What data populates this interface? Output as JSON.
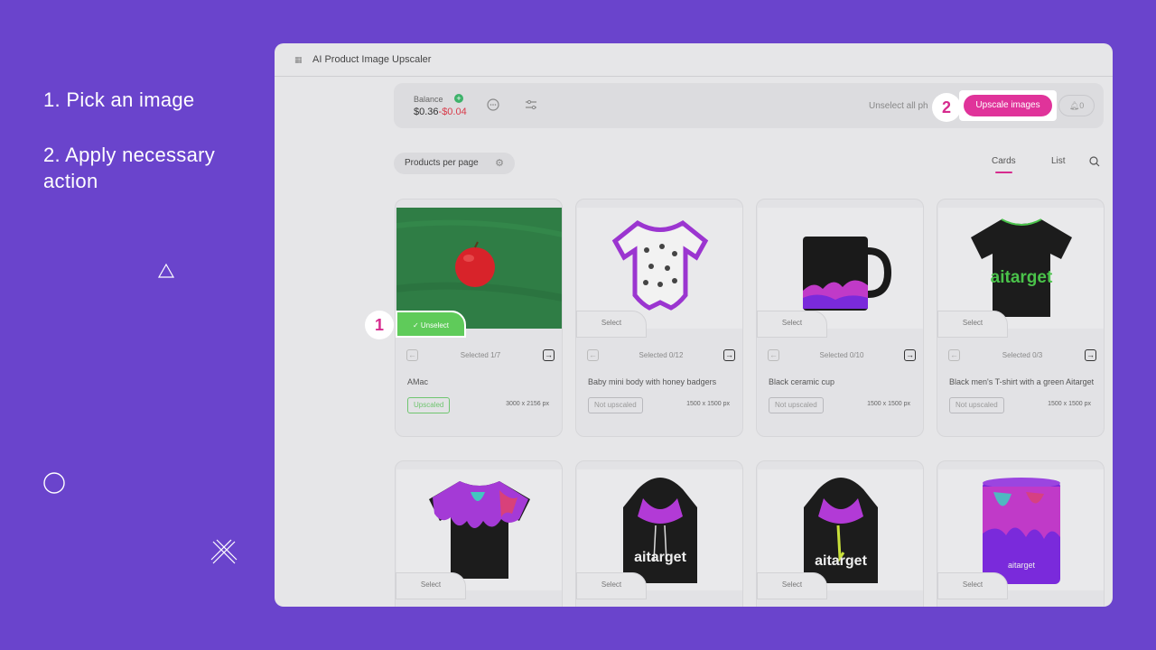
{
  "instructions": {
    "step1": "1. Pick an image",
    "step2": "2. Apply necessary action"
  },
  "window": {
    "title": "AI Product Image Upscaler"
  },
  "toolbar": {
    "balance_label": "Balance",
    "balance_plus": "+",
    "balance_value": "$0.36",
    "balance_deduct": "-$0.04",
    "unselect_all": "Unselect all ph",
    "upscale_label": "Upscale images",
    "notifications": "0"
  },
  "badges": {
    "one": "1",
    "two": "2"
  },
  "filters": {
    "products_per_page": "Products per page",
    "tab_cards": "Cards",
    "tab_list": "List"
  },
  "cards": [
    {
      "name": "AMac",
      "selected": "Selected 1/7",
      "status": "Upscaled",
      "dims": "3000 x 2156 px",
      "action": "Unselect"
    },
    {
      "name": "Baby mini body with honey badgers",
      "selected": "Selected 0/12",
      "status": "Not upscaled",
      "dims": "1500 x 1500 px",
      "action": "Select"
    },
    {
      "name": "Black ceramic cup",
      "selected": "Selected 0/10",
      "status": "Not upscaled",
      "dims": "1500 x 1500 px",
      "action": "Select"
    },
    {
      "name": "Black men's T-shirt with a green Aitarget",
      "selected": "Selected 0/3",
      "status": "Not upscaled",
      "dims": "1500 x 1500 px",
      "action": "Select"
    },
    {
      "action": "Select"
    },
    {
      "action": "Select"
    },
    {
      "action": "Select"
    },
    {
      "action": "Select"
    }
  ],
  "brand_text": "aitarget",
  "colors": {
    "background": "#6a44cc",
    "accent": "#e0339a",
    "upscaled_green": "#5fcb5a"
  }
}
